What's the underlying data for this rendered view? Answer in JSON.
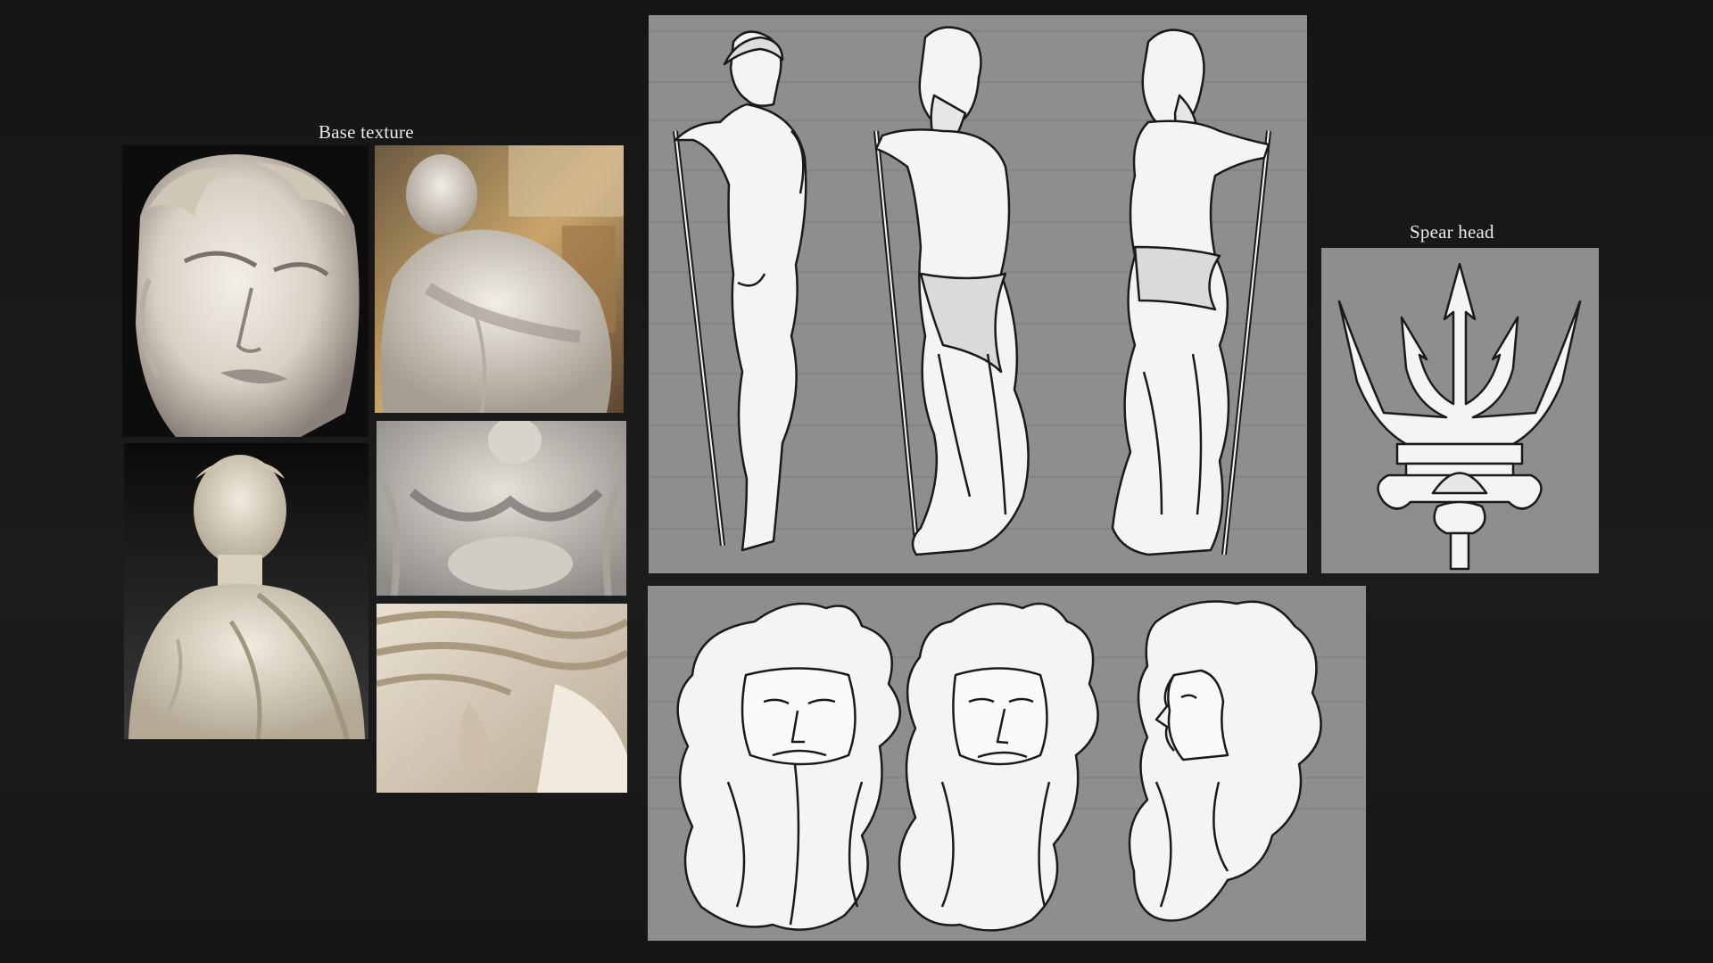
{
  "reference_board": {
    "label": "Base texture",
    "photos": [
      {
        "subject": "marble-david-face-closeup"
      },
      {
        "subject": "marble-david-torso-gallery"
      },
      {
        "subject": "marble-female-bust"
      },
      {
        "subject": "marble-drapery-detail"
      },
      {
        "subject": "marble-hair-ear-detail"
      }
    ]
  },
  "body_turnaround": {
    "views": [
      "side",
      "three-quarter",
      "back-three-quarter"
    ]
  },
  "spear_head": {
    "label": "Spear head",
    "icon": "trident-icon"
  },
  "head_turnaround": {
    "views": [
      "front",
      "three-quarter",
      "profile"
    ]
  },
  "colors": {
    "background": "#181818",
    "panel": "#8e8e8e",
    "line": "#1a1a1a",
    "marble": "#e8e2d8",
    "caption": "#e9e9e9"
  }
}
